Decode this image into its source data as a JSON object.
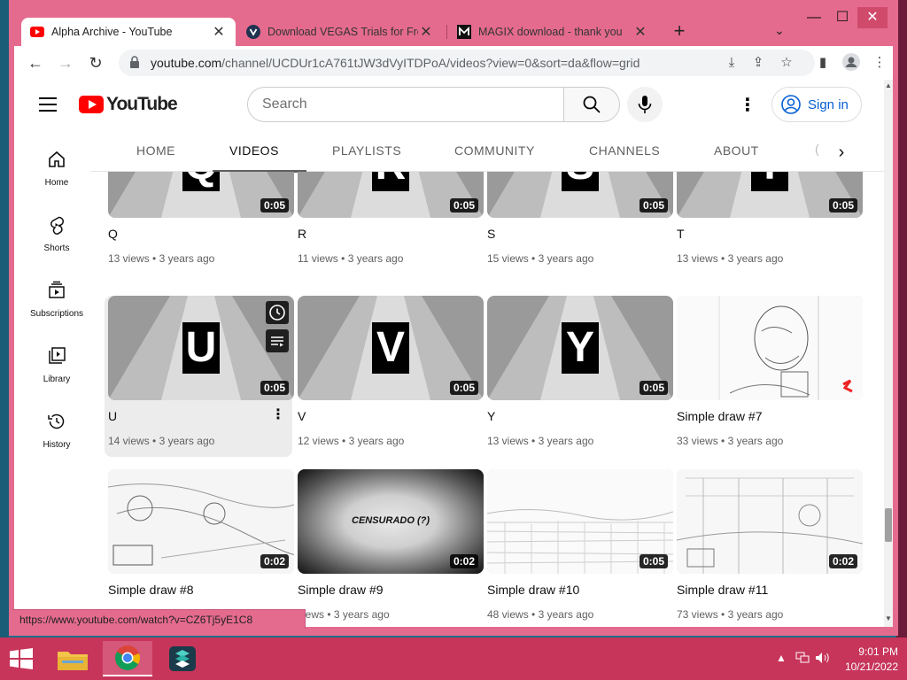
{
  "browser": {
    "tabs": [
      {
        "title": "Alpha Archive - YouTube",
        "active": true
      },
      {
        "title": "Download VEGAS Trials for Free",
        "active": false
      },
      {
        "title": "MAGIX download - thank you",
        "active": false
      }
    ],
    "url_host": "youtube.com",
    "url_path": "/channel/UCDUr1cA761tJW3dVyITDPoA/videos?view=0&sort=da&flow=grid",
    "status_url": "https://www.youtube.com/watch?v=CZ6Tj5yE1C8",
    "window_controls": {
      "minimize": "—",
      "maximize": "☐",
      "close": "✕"
    }
  },
  "youtube": {
    "logo_text": "YouTube",
    "search_placeholder": "Search",
    "sign_in": "Sign in",
    "rail": [
      {
        "label": "Home",
        "icon": "home-icon"
      },
      {
        "label": "Shorts",
        "icon": "shorts-icon"
      },
      {
        "label": "Subscriptions",
        "icon": "subscriptions-icon"
      },
      {
        "label": "Library",
        "icon": "library-icon"
      },
      {
        "label": "History",
        "icon": "history-icon"
      }
    ],
    "channel_tabs": [
      "HOME",
      "VIDEOS",
      "PLAYLISTS",
      "COMMUNITY",
      "CHANNELS",
      "ABOUT"
    ],
    "active_tab": "VIDEOS",
    "videos": [
      {
        "title": "Q",
        "views": "13 views",
        "age": "3 years ago",
        "duration": "0:05",
        "kind": "letter",
        "letter": "Q"
      },
      {
        "title": "R",
        "views": "11 views",
        "age": "3 years ago",
        "duration": "0:05",
        "kind": "letter",
        "letter": "R"
      },
      {
        "title": "S",
        "views": "15 views",
        "age": "3 years ago",
        "duration": "0:05",
        "kind": "letter",
        "letter": "S"
      },
      {
        "title": "T",
        "views": "13 views",
        "age": "3 years ago",
        "duration": "0:05",
        "kind": "letter",
        "letter": "T"
      },
      {
        "title": "U",
        "views": "14 views",
        "age": "3 years ago",
        "duration": "0:05",
        "kind": "letter",
        "letter": "U",
        "hovered": true
      },
      {
        "title": "V",
        "views": "12 views",
        "age": "3 years ago",
        "duration": "0:05",
        "kind": "letter",
        "letter": "V"
      },
      {
        "title": "Y",
        "views": "13 views",
        "age": "3 years ago",
        "duration": "0:05",
        "kind": "letter",
        "letter": "Y"
      },
      {
        "title": "Simple draw #7",
        "views": "33 views",
        "age": "3 years ago",
        "duration": "",
        "kind": "sketch"
      },
      {
        "title": "Simple draw #8",
        "views": "",
        "age": "",
        "duration": "0:02",
        "kind": "sketch"
      },
      {
        "title": "Simple draw #9",
        "views": "",
        "age": "3 years ago",
        "duration": "0:02",
        "kind": "censored",
        "overlay_text": "CENSURADO (?)"
      },
      {
        "title": "Simple draw #10",
        "views": "48 views",
        "age": "3 years ago",
        "duration": "0:05",
        "kind": "sketch"
      },
      {
        "title": "Simple draw #11",
        "views": "73 views",
        "age": "3 years ago",
        "duration": "0:02",
        "kind": "sketch"
      }
    ],
    "meta_separator": "•",
    "row4_views_partial": "views",
    "menu_dots": "⋮"
  },
  "taskbar": {
    "time": "9:01 PM",
    "date": "10/21/2022"
  },
  "colors": {
    "frame": "#e56b8e",
    "taskbar": "#c7355a",
    "yt_red": "#ff0000",
    "link_blue": "#065fd4"
  }
}
